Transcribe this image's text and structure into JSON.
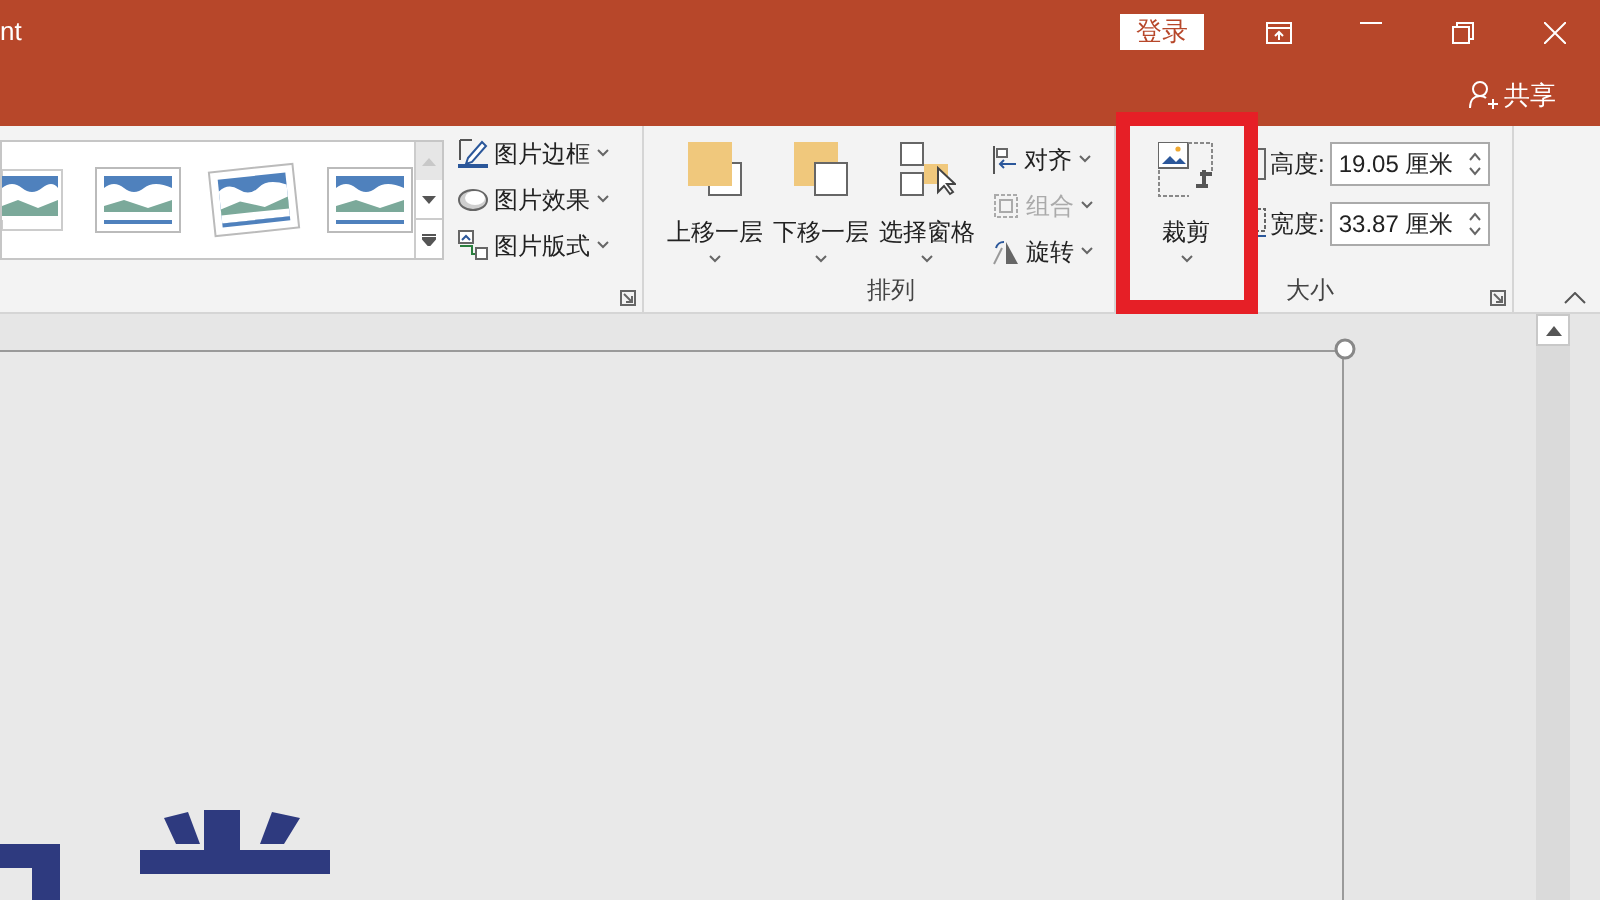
{
  "window": {
    "title": "nt",
    "sign_in": "登录",
    "share": "共享"
  },
  "picture_styles": {
    "commands": [
      {
        "label": "图片边框",
        "kind": "border"
      },
      {
        "label": "图片效果",
        "kind": "effects"
      },
      {
        "label": "图片版式",
        "kind": "layout"
      }
    ]
  },
  "arrange": {
    "label": "排列",
    "buttons": [
      {
        "label": "上移一层",
        "kind": "forward"
      },
      {
        "label": "下移一层",
        "kind": "backward"
      },
      {
        "label": "选择窗格",
        "kind": "pane"
      }
    ],
    "commands": [
      {
        "label": "对齐",
        "kind": "align",
        "disabled": false
      },
      {
        "label": "组合",
        "kind": "group",
        "disabled": true
      },
      {
        "label": "旋转",
        "kind": "rotate",
        "disabled": false
      }
    ]
  },
  "crop": {
    "label": "裁剪",
    "highlighted": true
  },
  "size": {
    "label": "大小",
    "fields": [
      {
        "label": "高度:",
        "value": "19.05 厘米",
        "kind": "height"
      },
      {
        "label": "宽度:",
        "value": "33.87 厘米",
        "kind": "width"
      }
    ]
  }
}
